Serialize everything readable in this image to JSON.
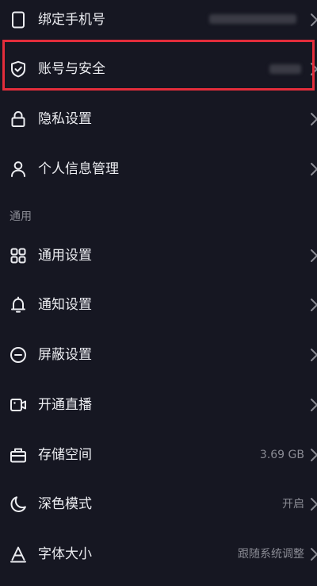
{
  "settings": {
    "account_items": [
      {
        "label": "绑定手机号",
        "icon": "phone-icon",
        "value": ""
      },
      {
        "label": "账号与安全",
        "icon": "shield-check-icon",
        "value": ""
      },
      {
        "label": "隐私设置",
        "icon": "lock-icon",
        "value": ""
      },
      {
        "label": "个人信息管理",
        "icon": "person-icon",
        "value": ""
      }
    ],
    "section_general": "通用",
    "general_items": [
      {
        "label": "通用设置",
        "icon": "grid-icon",
        "value": ""
      },
      {
        "label": "通知设置",
        "icon": "bell-icon",
        "value": ""
      },
      {
        "label": "屏蔽设置",
        "icon": "block-icon",
        "value": ""
      },
      {
        "label": "开通直播",
        "icon": "live-camera-icon",
        "value": ""
      },
      {
        "label": "存储空间",
        "icon": "storage-icon",
        "value": "3.69 GB"
      },
      {
        "label": "深色模式",
        "icon": "moon-icon",
        "value": "开启"
      },
      {
        "label": "字体大小",
        "icon": "font-icon",
        "value": "跟随系统调整"
      }
    ]
  },
  "colors": {
    "background": "#161722",
    "text": "#ecedf1",
    "secondary_text": "#8a8b94",
    "highlight": "#e32d3b"
  }
}
